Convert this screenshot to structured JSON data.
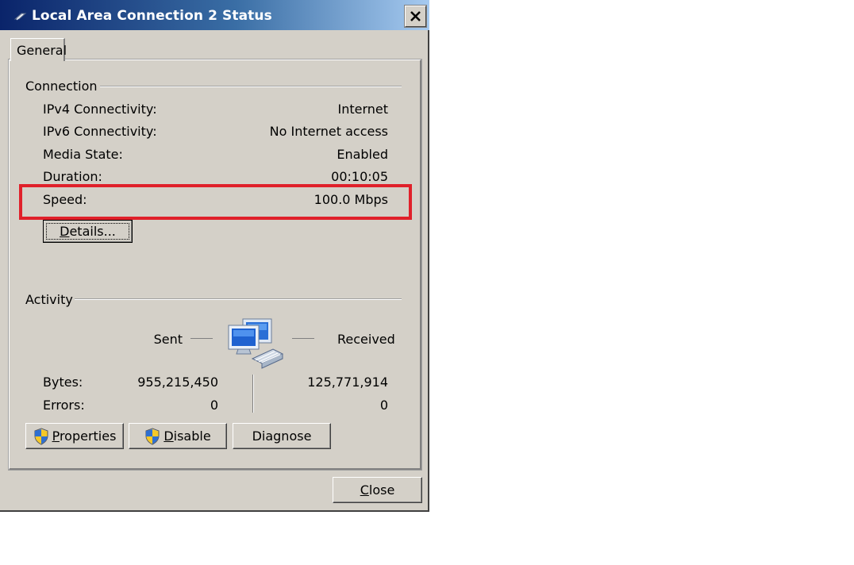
{
  "window": {
    "title": "Local Area Connection 2 Status"
  },
  "tabs": [
    {
      "label": "General"
    }
  ],
  "connection": {
    "heading": "Connection",
    "rows": [
      {
        "label": "IPv4 Connectivity:",
        "value": "Internet"
      },
      {
        "label": "IPv6 Connectivity:",
        "value": "No Internet access"
      },
      {
        "label": "Media State:",
        "value": "Enabled"
      },
      {
        "label": "Duration:",
        "value": "00:10:05"
      },
      {
        "label": "Speed:",
        "value": "100.0 Mbps"
      }
    ],
    "details_button": {
      "prefix": "",
      "accel": "D",
      "rest": "etails..."
    }
  },
  "activity": {
    "heading": "Activity",
    "sent_label": "Sent",
    "received_label": "Received",
    "bytes_label": "Bytes:",
    "bytes_sent": "955,215,450",
    "bytes_received": "125,771,914",
    "errors_label": "Errors:",
    "errors_sent": "0",
    "errors_received": "0"
  },
  "buttons": {
    "properties": {
      "accel": "P",
      "rest": "roperties"
    },
    "disable": {
      "accel": "D",
      "rest": "isable"
    },
    "diagnose": {
      "label": "Diagnose"
    },
    "close": {
      "accel": "C",
      "rest": "lose"
    }
  },
  "icons": {
    "title": "network-connection-icon",
    "activity": "network-computers-icon",
    "shield": "uac-shield-icon",
    "close": "close-x-icon"
  },
  "colors": {
    "highlight": "#e0202a",
    "titlebar": "#0a246a"
  }
}
